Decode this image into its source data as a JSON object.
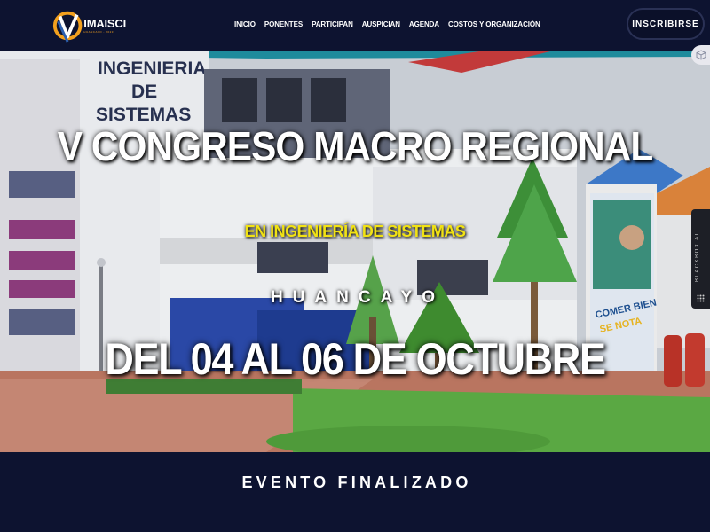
{
  "header": {
    "logo_text": "IMAISCI",
    "logo_subtext": "HUANCAYO - 2023",
    "nav": [
      "INICIO",
      "PONENTES",
      "PARTICIPAN",
      "AUSPICIAN",
      "AGENDA",
      "COSTOS Y ORGANIZACIÓN"
    ],
    "cta_label": "INSCRIBIRSE"
  },
  "hero": {
    "title": "V CONGRESO MACRO REGIONAL",
    "subtitle": "EN INGENIERÍA DE SISTEMAS",
    "city": "HUANCAYO",
    "dates": "DEL 04 AL 06 DE OCTUBRE",
    "building_sign": "INGENIERÍA DE SISTEMAS",
    "banner_text": "COMER BIEN SE NOTA",
    "subtitle_color": "#f1e214"
  },
  "side": {
    "tab_label": "BLACKBOX AI"
  },
  "footer": {
    "status": "EVENTO FINALIZADO"
  },
  "colors": {
    "navy": "#0d1330",
    "accent_orange": "#f2a01e",
    "accent_teal": "#1e8b9c"
  }
}
